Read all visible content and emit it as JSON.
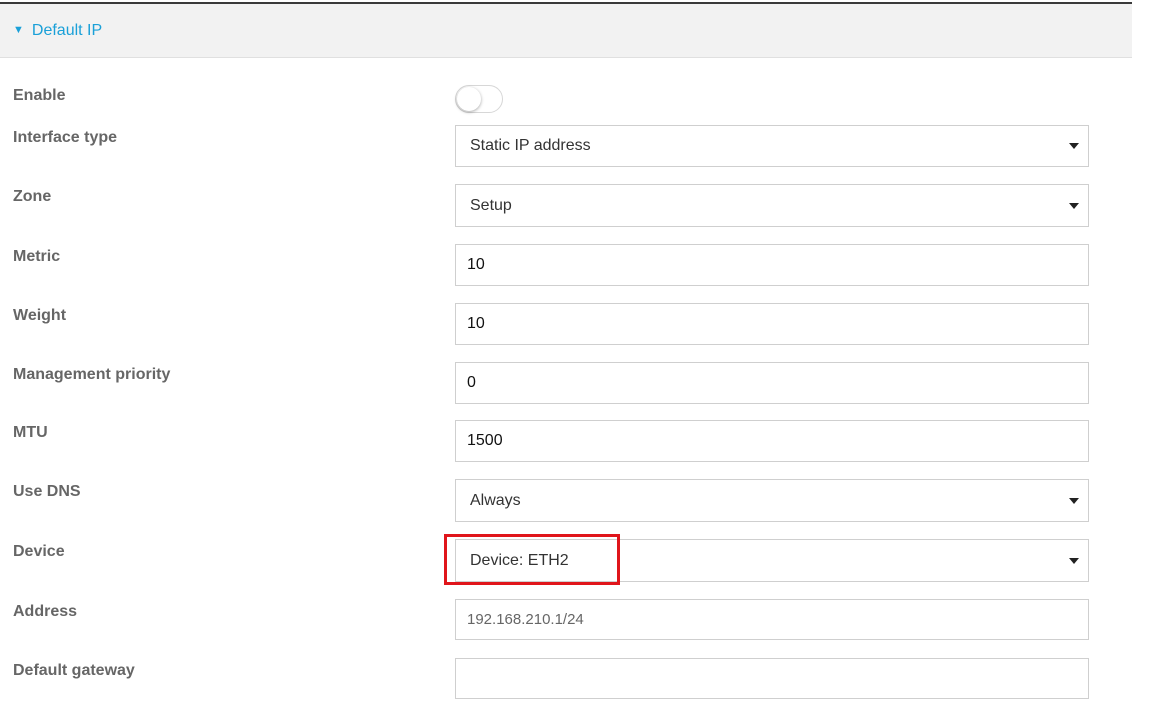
{
  "section": {
    "title": "Default IP",
    "caret_icon": "caret-down-icon",
    "accent_color": "#1aa0d8"
  },
  "fields": {
    "enable": {
      "label": "Enable",
      "enabled": false
    },
    "interface_type": {
      "label": "Interface type",
      "value": "Static IP address"
    },
    "zone": {
      "label": "Zone",
      "value": "Setup"
    },
    "metric": {
      "label": "Metric",
      "value": "10"
    },
    "weight": {
      "label": "Weight",
      "value": "10"
    },
    "management_priority": {
      "label": "Management priority",
      "value": "0"
    },
    "mtu": {
      "label": "MTU",
      "value": "1500"
    },
    "use_dns": {
      "label": "Use DNS",
      "value": "Always"
    },
    "device": {
      "label": "Device",
      "value": "Device: ETH2"
    },
    "address": {
      "label": "Address",
      "value": "192.168.210.1/24"
    },
    "default_gateway": {
      "label": "Default gateway",
      "value": ""
    }
  },
  "annotation": {
    "highlight_color": "#e0151b"
  }
}
